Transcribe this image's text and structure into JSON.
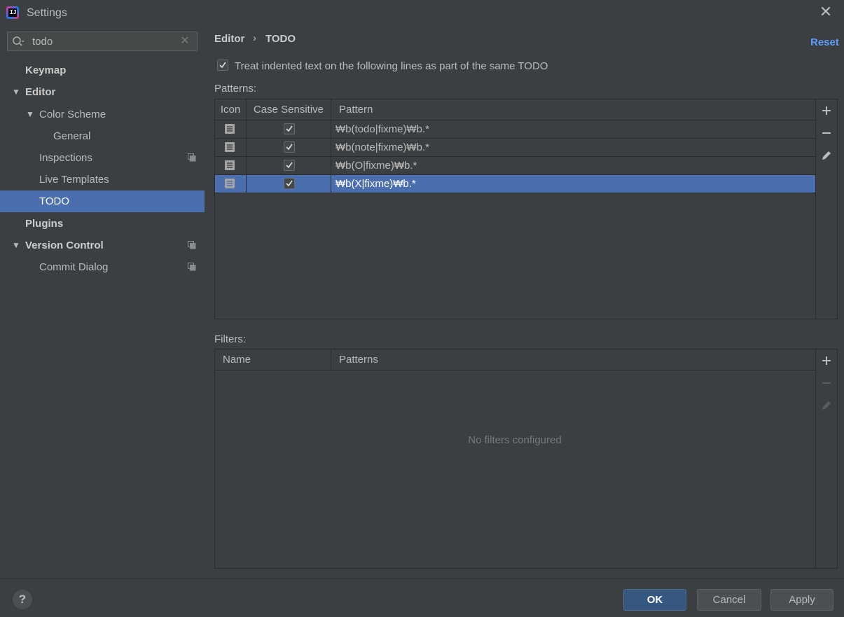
{
  "window": {
    "title": "Settings",
    "icon_text": "IJ"
  },
  "search": {
    "value": "todo"
  },
  "sidebar": {
    "items": [
      {
        "label": "Keymap"
      },
      {
        "label": "Editor"
      },
      {
        "label": "Color Scheme"
      },
      {
        "label": "General"
      },
      {
        "label": "Inspections"
      },
      {
        "label": "Live Templates"
      },
      {
        "label": "TODO"
      },
      {
        "label": "Plugins"
      },
      {
        "label": "Version Control"
      },
      {
        "label": "Commit Dialog"
      }
    ],
    "selected": "TODO"
  },
  "breadcrumb": {
    "parent": "Editor",
    "separator": "›",
    "current": "TODO"
  },
  "reset_label": "Reset",
  "treat_indented": {
    "label": "Treat indented text on the following lines as part of the same TODO",
    "checked": true
  },
  "patterns": {
    "label": "Patterns:",
    "columns": [
      "Icon",
      "Case Sensitive",
      "Pattern"
    ],
    "rows": [
      {
        "pattern": "₩b(todo|fixme)₩b.*",
        "case_sensitive": true
      },
      {
        "pattern": "₩b(note|fixme)₩b.*",
        "case_sensitive": true
      },
      {
        "pattern": "₩b(O|fixme)₩b.*",
        "case_sensitive": true
      },
      {
        "pattern": "₩b(X|fixme)₩b.*",
        "case_sensitive": true,
        "selected": true
      }
    ]
  },
  "filters": {
    "label": "Filters:",
    "columns": [
      "Name",
      "Patterns"
    ],
    "empty_text": "No filters configured"
  },
  "buttons": {
    "help": "?",
    "ok": "OK",
    "cancel": "Cancel",
    "apply": "Apply"
  },
  "colors": {
    "background": "#3c3f41",
    "selection": "#4b6eaf",
    "link": "#589df6",
    "ok_button": "#365880"
  }
}
